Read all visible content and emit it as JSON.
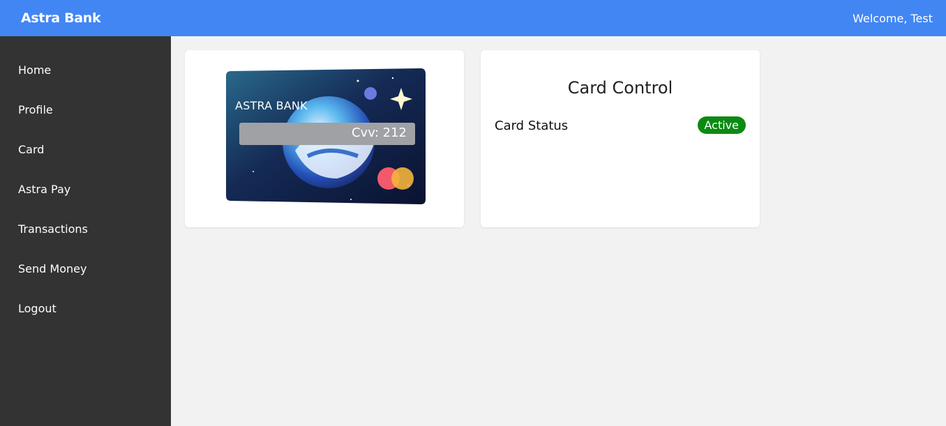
{
  "header": {
    "brand": "Astra Bank",
    "welcome": "Welcome, Test"
  },
  "sidebar": {
    "items": [
      {
        "label": "Home"
      },
      {
        "label": "Profile"
      },
      {
        "label": "Card"
      },
      {
        "label": "Astra Pay"
      },
      {
        "label": "Transactions"
      },
      {
        "label": "Send Money"
      },
      {
        "label": "Logout"
      }
    ]
  },
  "card": {
    "brand_text": "ASTRA BANK",
    "cvv_text": "Cvv: 212",
    "network_icon": "mastercard-logo"
  },
  "card_control": {
    "title": "Card Control",
    "status_label": "Card Status",
    "status_value": "Active"
  },
  "colors": {
    "header_bg": "#4286f4",
    "sidebar_bg": "#333333",
    "page_bg": "#f2f2f2",
    "active_badge": "#0b8a12"
  }
}
